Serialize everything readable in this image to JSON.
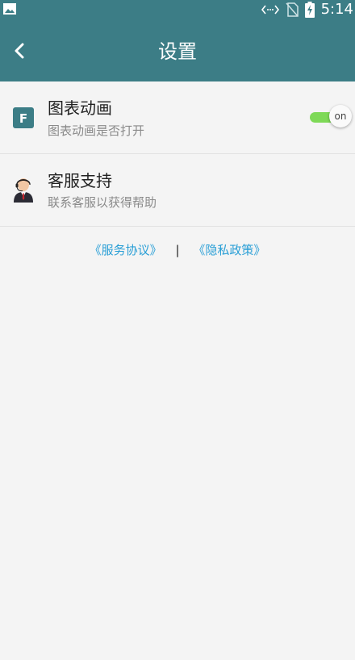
{
  "status_bar": {
    "time": "5:14",
    "icons": [
      "image-icon",
      "data-arrows-icon",
      "no-sim-icon",
      "battery-charging-icon"
    ]
  },
  "header": {
    "title": "设置",
    "back_icon": "chevron-left-icon"
  },
  "settings": [
    {
      "icon": "f-badge-icon",
      "title": "图表动画",
      "subtitle": "图表动画是否打开",
      "toggle_label": "on",
      "toggle_on": true
    },
    {
      "icon": "customer-service-avatar-icon",
      "title": "客服支持",
      "subtitle": "联系客服以获得帮助"
    }
  ],
  "links": {
    "service_agreement": "《服务协议》",
    "separator": "|",
    "privacy_policy": "《隐私政策》"
  },
  "colors": {
    "primary": "#3c7d86",
    "toggle_on": "#7ed957",
    "link": "#2a9fd6",
    "background": "#f4f4f4"
  }
}
